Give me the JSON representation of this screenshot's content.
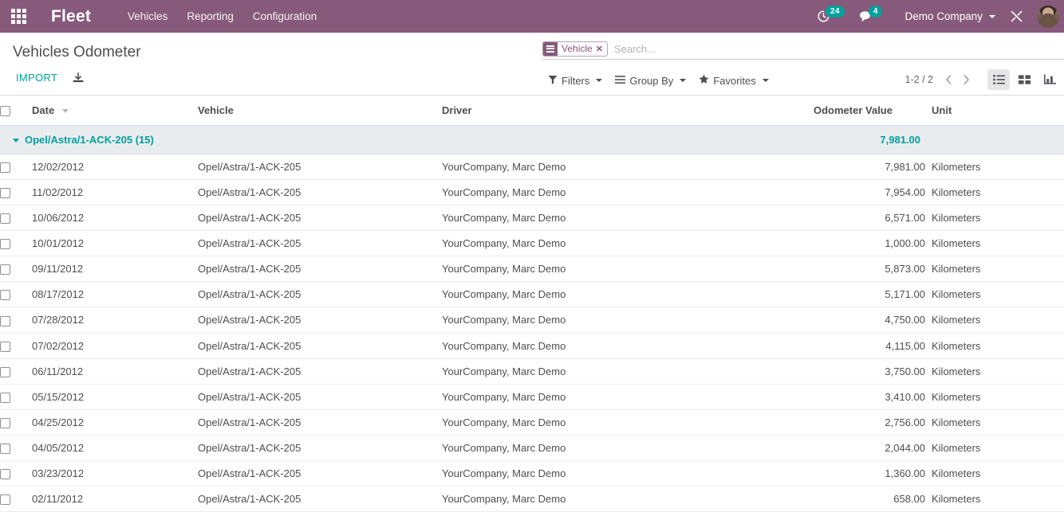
{
  "navbar": {
    "apps_icon": "apps-grid-icon",
    "brand": "Fleet",
    "menus": [
      "Vehicles",
      "Reporting",
      "Configuration"
    ],
    "systray": {
      "activity_icon": "clock-activity-icon",
      "activity_count": "24",
      "messages_icon": "chat-bubble-icon",
      "messages_count": "4",
      "company": "Demo Company",
      "tools_icon": "debug-tools-icon",
      "avatar_icon": "user-avatar"
    },
    "accent_color": "#875A7B",
    "badge_color": "#00A09D"
  },
  "control_panel": {
    "breadcrumb": "Vehicles Odometer",
    "import_label": "IMPORT",
    "download_icon": "download-icon",
    "search": {
      "facet_icon": "group-by-bars-icon",
      "facet_label": "Vehicle",
      "facet_remove": "✕",
      "placeholder": "Search..."
    },
    "buttons": [
      {
        "label": "Filters",
        "icon": "filter-funnel-icon"
      },
      {
        "label": "Group By",
        "icon": "group-by-bars-icon"
      },
      {
        "label": "Favorites",
        "icon": "star-icon"
      }
    ],
    "pager": {
      "range": "1-2 / 2",
      "prev_icon": "chevron-left-icon",
      "next_icon": "chevron-right-icon"
    },
    "views": [
      {
        "name": "list-view",
        "icon": "list-icon",
        "active": true
      },
      {
        "name": "kanban-view",
        "icon": "kanban-icon",
        "active": false
      },
      {
        "name": "graph-view",
        "icon": "bar-chart-icon",
        "active": false
      }
    ]
  },
  "list": {
    "columns": [
      "Date",
      "Vehicle",
      "Driver",
      "Odometer Value",
      "Unit"
    ],
    "sort_column": "Date",
    "group": {
      "label": "Opel/Astra/1-ACK-205 (15)",
      "total": "7,981.00"
    },
    "rows": [
      {
        "date": "12/02/2012",
        "vehicle": "Opel/Astra/1-ACK-205",
        "driver": "YourCompany, Marc Demo",
        "odometer": "7,981.00",
        "unit": "Kilometers"
      },
      {
        "date": "11/02/2012",
        "vehicle": "Opel/Astra/1-ACK-205",
        "driver": "YourCompany, Marc Demo",
        "odometer": "7,954.00",
        "unit": "Kilometers"
      },
      {
        "date": "10/06/2012",
        "vehicle": "Opel/Astra/1-ACK-205",
        "driver": "YourCompany, Marc Demo",
        "odometer": "6,571.00",
        "unit": "Kilometers"
      },
      {
        "date": "10/01/2012",
        "vehicle": "Opel/Astra/1-ACK-205",
        "driver": "YourCompany, Marc Demo",
        "odometer": "1,000.00",
        "unit": "Kilometers"
      },
      {
        "date": "09/11/2012",
        "vehicle": "Opel/Astra/1-ACK-205",
        "driver": "YourCompany, Marc Demo",
        "odometer": "5,873.00",
        "unit": "Kilometers"
      },
      {
        "date": "08/17/2012",
        "vehicle": "Opel/Astra/1-ACK-205",
        "driver": "YourCompany, Marc Demo",
        "odometer": "5,171.00",
        "unit": "Kilometers"
      },
      {
        "date": "07/28/2012",
        "vehicle": "Opel/Astra/1-ACK-205",
        "driver": "YourCompany, Marc Demo",
        "odometer": "4,750.00",
        "unit": "Kilometers"
      },
      {
        "date": "07/02/2012",
        "vehicle": "Opel/Astra/1-ACK-205",
        "driver": "YourCompany, Marc Demo",
        "odometer": "4,115.00",
        "unit": "Kilometers"
      },
      {
        "date": "06/11/2012",
        "vehicle": "Opel/Astra/1-ACK-205",
        "driver": "YourCompany, Marc Demo",
        "odometer": "3,750.00",
        "unit": "Kilometers"
      },
      {
        "date": "05/15/2012",
        "vehicle": "Opel/Astra/1-ACK-205",
        "driver": "YourCompany, Marc Demo",
        "odometer": "3,410.00",
        "unit": "Kilometers"
      },
      {
        "date": "04/25/2012",
        "vehicle": "Opel/Astra/1-ACK-205",
        "driver": "YourCompany, Marc Demo",
        "odometer": "2,756.00",
        "unit": "Kilometers"
      },
      {
        "date": "04/05/2012",
        "vehicle": "Opel/Astra/1-ACK-205",
        "driver": "YourCompany, Marc Demo",
        "odometer": "2,044.00",
        "unit": "Kilometers"
      },
      {
        "date": "03/23/2012",
        "vehicle": "Opel/Astra/1-ACK-205",
        "driver": "YourCompany, Marc Demo",
        "odometer": "1,360.00",
        "unit": "Kilometers"
      },
      {
        "date": "02/11/2012",
        "vehicle": "Opel/Astra/1-ACK-205",
        "driver": "YourCompany, Marc Demo",
        "odometer": "658.00",
        "unit": "Kilometers"
      }
    ]
  }
}
